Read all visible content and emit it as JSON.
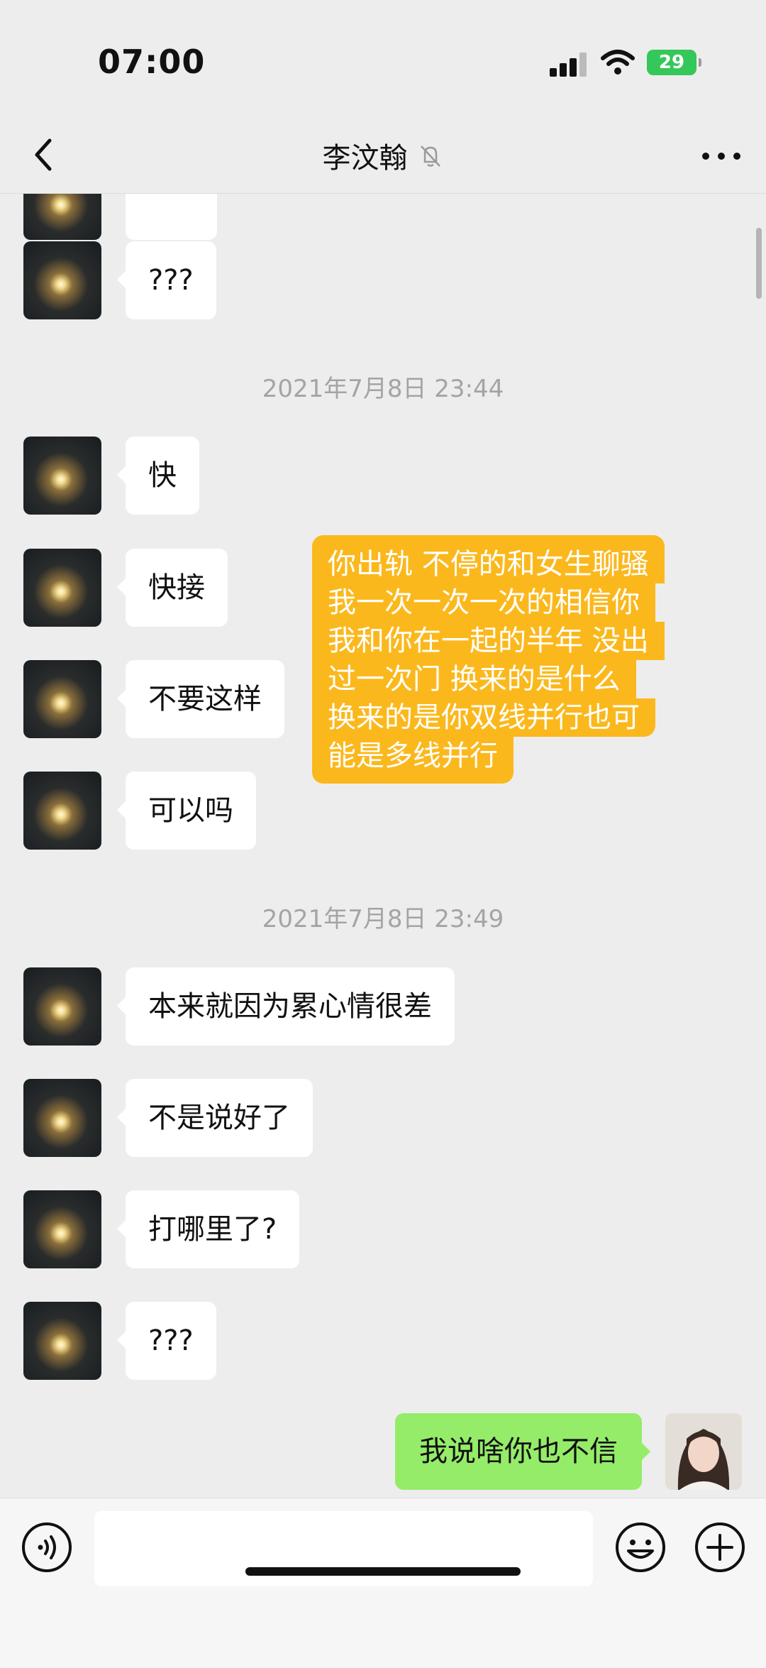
{
  "status": {
    "time": "07:00",
    "battery": "29"
  },
  "header": {
    "title": "李汶翰"
  },
  "messages": {
    "m0": "???",
    "ts1": "2021年7月8日 23:44",
    "m1": "快",
    "m2": "快接",
    "m3": "不要这样",
    "m4": "可以吗",
    "m5_lines": [
      "你出轨 不停的和女生聊骚",
      "我一次一次一次的相信你",
      "我和你在一起的半年 没出",
      "过一次门 换来的是什么",
      "换来的是你双线并行也可",
      "能是多线并行"
    ],
    "ts2": "2021年7月8日 23:49",
    "m6": "本来就因为累心情很差",
    "m7": "不是说好了",
    "m8": "打哪里了?",
    "m9": "???",
    "m10": "我说啥你也不信"
  },
  "icons": {
    "back": "chevron-left-icon",
    "mute": "bell-slash-icon",
    "more": "ellipsis-icon",
    "voice": "voice-icon",
    "emoji": "emoji-icon",
    "plus": "plus-circle-icon"
  },
  "colors": {
    "background": "#ededed",
    "incoming_bubble": "#ffffff",
    "highlight": "#fbb81d",
    "outgoing_bubble": "#95ec69",
    "battery": "#34c759"
  }
}
